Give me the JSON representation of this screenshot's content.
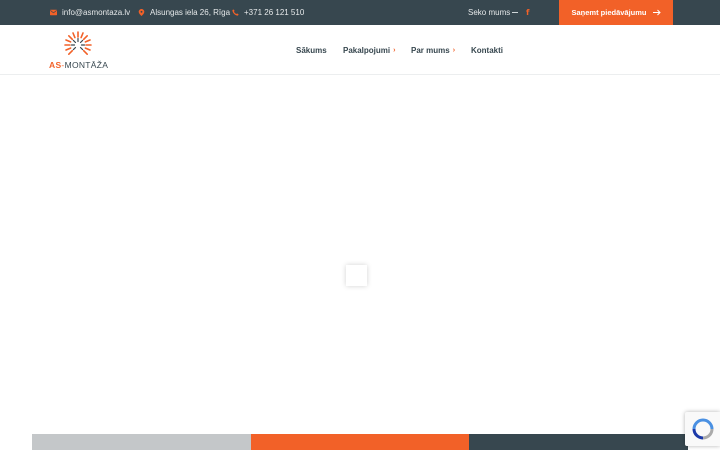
{
  "topbar": {
    "email": "info@asmontaza.lv",
    "address": "Alsungas iela 26, Rīga",
    "phone": "+371 26 121 510",
    "follow_label": "Seko mums",
    "facebook_glyph": "f",
    "cta_label": "Saņemt piedāvājumu",
    "cta_arrow": "→"
  },
  "logo": {
    "as": "AS",
    "separator": "-",
    "name": "MONTĀŽA"
  },
  "nav": {
    "items": [
      {
        "label": "Sākums",
        "has_submenu": false
      },
      {
        "label": "Pakalpojumi",
        "has_submenu": true
      },
      {
        "label": "Par mums",
        "has_submenu": true
      },
      {
        "label": "Kontakti",
        "has_submenu": false
      }
    ],
    "submenu_glyph": "›"
  },
  "colors": {
    "accent": "#f26128",
    "dark": "#37474f",
    "light_gray": "#c4c7c9",
    "dark_strip": "#37474f"
  },
  "icons": {
    "email": "envelope-icon",
    "address": "map-pin-icon",
    "phone": "phone-icon",
    "facebook": "facebook-icon",
    "cta": "arrow-right-icon",
    "recaptcha": "recaptcha-icon"
  }
}
